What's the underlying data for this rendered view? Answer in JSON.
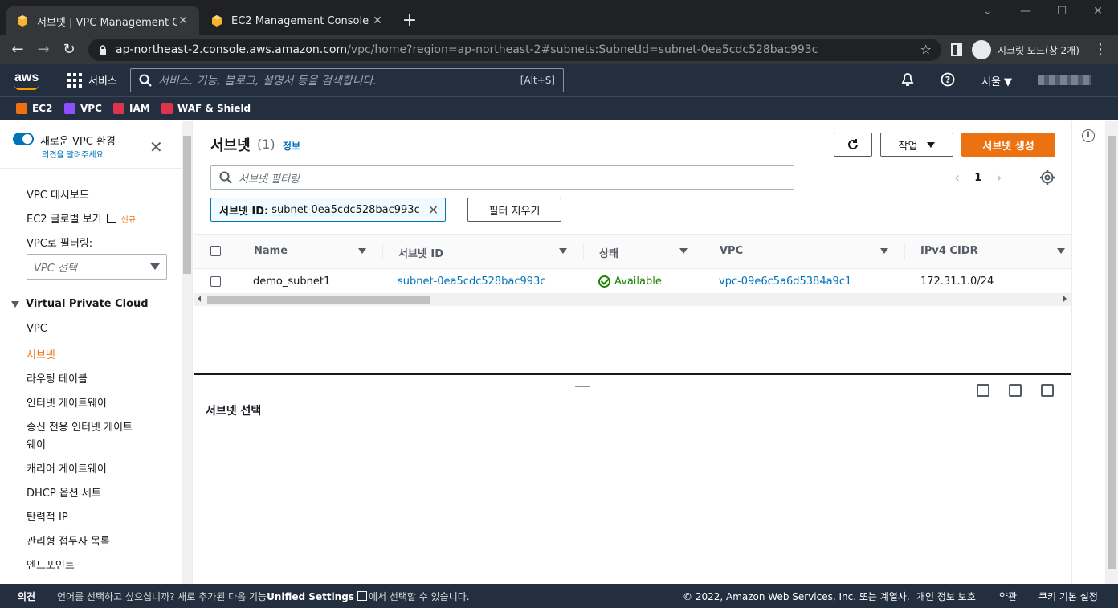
{
  "browser": {
    "tabs": [
      {
        "title": "서브넷 | VPC Management Conso",
        "active": true
      },
      {
        "title": "EC2 Management Console",
        "active": false
      }
    ],
    "new_tab": "+",
    "url_host": "ap-northeast-2.console.aws.amazon.com",
    "url_path": "/vpc/home?region=ap-northeast-2#subnets:SubnetId=subnet-0ea5cdc528bac993c",
    "incognito_label": "시크릿 모드(창 2개)"
  },
  "aws_header": {
    "logo": "aws",
    "services_label": "서비스",
    "search_placeholder": "서비스, 기능, 블로그, 설명서 등을 검색합니다.",
    "search_shortcut": "[Alt+S]",
    "region": "서울 ▼",
    "favorites": [
      {
        "label": "EC2",
        "color": "#ec7211"
      },
      {
        "label": "VPC",
        "color": "#8c4fff"
      },
      {
        "label": "IAM",
        "color": "#dd344c"
      },
      {
        "label": "WAF & Shield",
        "color": "#dd344c"
      }
    ]
  },
  "sidebar": {
    "toggle_label": "새로운 VPC 환경",
    "feedback_link": "의견을 알려주세요",
    "dashboard": "VPC 대시보드",
    "global_view": "EC2 글로벌 보기",
    "new_badge": "신규",
    "filter_label": "VPC로 필터링:",
    "filter_placeholder": "VPC 선택",
    "section": "Virtual Private Cloud",
    "items": [
      "VPC",
      "서브넷",
      "라우팅 테이블",
      "인터넷 게이트웨이",
      "송신 전용 인터넷 게이트",
      "웨이",
      "캐리어 게이트웨이",
      "DHCP 옵션 세트",
      "탄력적 IP",
      "관리형 접두사 목록",
      "엔드포인트"
    ]
  },
  "main": {
    "title": "서브넷",
    "count": "(1)",
    "info_link": "정보",
    "actions_label": "작업",
    "create_label": "서브넷 생성",
    "filter_placeholder": "서브넷 필터링",
    "page": "1",
    "token_key": "서브넷 ID:",
    "token_value": "subnet-0ea5cdc528bac993c",
    "clear_filter": "필터 지우기",
    "columns": [
      "Name",
      "서브넷 ID",
      "상태",
      "VPC",
      "IPv4 CIDR"
    ],
    "rows": [
      {
        "name": "demo_subnet1",
        "subnet_id": "subnet-0ea5cdc528bac993c",
        "state": "Available",
        "vpc": "vpc-09e6c5a6d5384a9c1",
        "cidr": "172.31.1.0/24"
      }
    ],
    "detail_title": "서브넷 선택"
  },
  "footer": {
    "feedback": "의견",
    "lang_msg_1": "언어를 선택하고 싶으십니까? 새로 추가된 다음 기능",
    "lang_link": "Unified Settings",
    "lang_msg_2": "에서 선택할 수 있습니다.",
    "copyright": "© 2022, Amazon Web Services, Inc. 또는 계열사.",
    "privacy": "개인 정보 보호",
    "terms": "약관",
    "cookies": "쿠키 기본 설정"
  },
  "colors": {
    "aws_nav": "#232f3e",
    "primary": "#ec7211",
    "link": "#0073bb",
    "success": "#1d8102"
  }
}
